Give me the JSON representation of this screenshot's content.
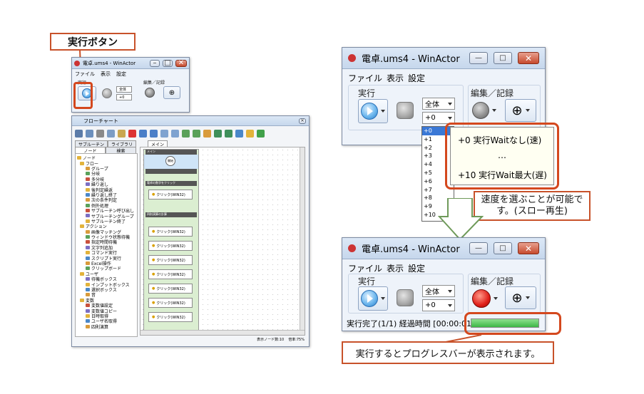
{
  "callouts": {
    "run_button": "実行ボタン",
    "speed_select": "速度を選ぶことが可能です。(スロー再生)",
    "progress_bar": "実行するとプログレスバーが表示されます。"
  },
  "small_window": {
    "title": "電卓.ums4 - WinActor",
    "menu": [
      "ファイル",
      "表示",
      "設定"
    ],
    "group_run": "実行",
    "group_edit": "編集／記録",
    "combo_scope": "全体",
    "combo_speed": "+0"
  },
  "flowchart": {
    "title": "フローチャート",
    "tabs": [
      "サブルーチン",
      "ライブラリ",
      "メイン"
    ],
    "subtabs": [
      "ノード",
      "検索"
    ],
    "tree": [
      "ノード",
      "フロー",
      "グループ",
      "分岐",
      "多分岐",
      "繰り返し",
      "後判定繰返",
      "繰り返し終了",
      "次の条件判定",
      "例外処理",
      "サブルーチン呼び出し",
      "サブルーチングループ",
      "サブルーチン終了",
      "アクション",
      "画像マッチング",
      "ウィンドウ状態待機",
      "指定時間待機",
      "文字列追加",
      "コマンド実行",
      "スクリプト実行",
      "Excel操作",
      "クリップボード",
      "ユーザ",
      "待機ボックス",
      "インプットボックス",
      "選択ボックス",
      "音",
      "変数",
      "変数値設定",
      "変数値コピー",
      "日時取得",
      "ユーザ名取得",
      "四則演算"
    ],
    "start_label": "開始",
    "flow_header": "メイン",
    "group1": "電卓の数字をクリック",
    "group2": "四則演算の計算",
    "click_node": "クリック(WIN32)",
    "status_nodes": "表示ノード数:10",
    "status_zoom": "倍率:75%"
  },
  "main_window_top": {
    "title": "電卓.ums4 - WinActor",
    "menu": [
      "ファイル",
      "表示",
      "設定"
    ],
    "group_run": "実行",
    "group_edit": "編集／記録",
    "combo_scope": "全体",
    "combo_speed": "+0",
    "speed_options": [
      "+0",
      "+1",
      "+2",
      "+3",
      "+4",
      "+5",
      "+6",
      "+7",
      "+8",
      "+9",
      "+10"
    ]
  },
  "speed_tooltip": {
    "line1": "+0 実行Waitなし(速)",
    "line2": "…",
    "line3": "+10 実行Wait最大(遅)"
  },
  "main_window_bottom": {
    "title": "電卓.ums4 - WinActor",
    "menu": [
      "ファイル",
      "表示",
      "設定"
    ],
    "group_run": "実行",
    "group_edit": "編集／記録",
    "combo_scope": "全体",
    "combo_speed": "+0",
    "status": "実行完了(1/1) 経過時間 [00:00:01]",
    "progress": 1.0
  },
  "colors": {
    "callout_border": "#c8522a",
    "highlight": "#d4481e",
    "progress_fill": "#4fc85a",
    "arrow_fill": "#ffffff",
    "arrow_stroke": "#6f9a5a"
  }
}
